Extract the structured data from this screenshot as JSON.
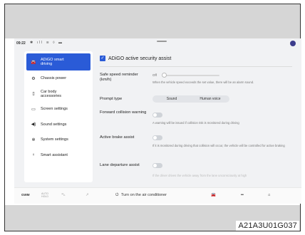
{
  "status": {
    "time": "09:22",
    "icons": "✱ ıll ≋ ◊ ▬"
  },
  "sidebar": {
    "items": [
      {
        "icon": "🚘",
        "label_line1": "ADiGO smart",
        "label_line2": "driving",
        "active": true
      },
      {
        "icon": "⚙",
        "label_line1": "Chassis power",
        "label_line2": ""
      },
      {
        "icon": "▯",
        "label_line1": "Car body",
        "label_line2": "accessories"
      },
      {
        "icon": "▭",
        "label_line1": "Screen settings",
        "label_line2": ""
      },
      {
        "icon": "◀)",
        "label_line1": "Sound settings",
        "label_line2": ""
      },
      {
        "icon": "✲",
        "label_line1": "System settings",
        "label_line2": ""
      },
      {
        "icon": "♀",
        "label_line1": "Smart assistant",
        "label_line2": ""
      }
    ]
  },
  "panel": {
    "title": "ADiGO active security assist",
    "rows": {
      "speed": {
        "label": "Safe speed reminder (km/h)",
        "value": "Off",
        "desc": "When the vehicle speed exceeds the set value, there will be an alarm sound."
      },
      "prompt": {
        "label": "Prompt type",
        "options": [
          "Sound",
          "Human voice"
        ]
      },
      "fcw": {
        "label": "Forward collision warning",
        "desc": "A warning will be issued if collision risk is monitored during driving"
      },
      "brake": {
        "label": "Active brake assist",
        "desc": "If it is monitored during driving that collision will occur, the vehicle will be controlled for active braking"
      },
      "lane": {
        "label": "Lane departure assist",
        "desc": "If the driver drives the vehicle away from the lane unconsciously at high"
      }
    }
  },
  "taskbar": {
    "brand": "GWM",
    "auto_hold": "AUTO HOLD",
    "ac_label": "Turn on the air conditioner"
  },
  "caption": "A21A3U01G037"
}
